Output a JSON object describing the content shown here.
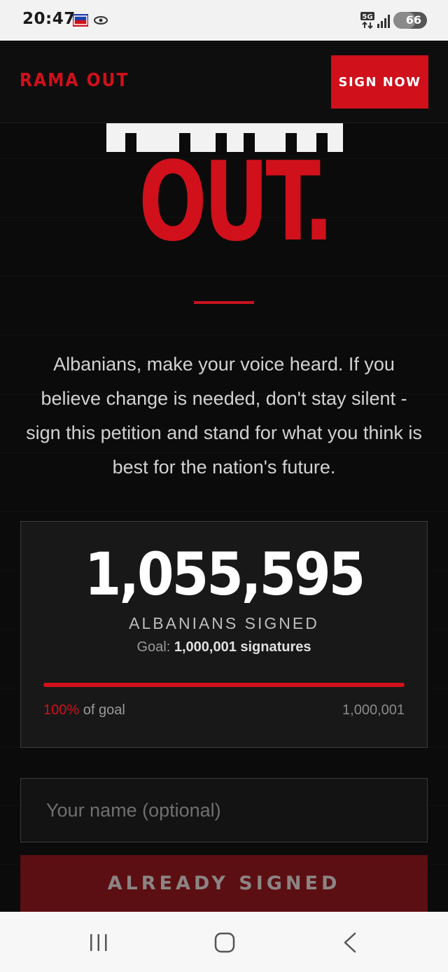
{
  "status_bar": {
    "time": "20:47",
    "battery": "66"
  },
  "header": {
    "brand": "RAMA OUT",
    "cta_label": "SIGN NOW"
  },
  "hero": {
    "title_top": "RAMA",
    "title_bottom": "OUT."
  },
  "intro": "Albanians, make your voice heard. If you believe change is needed, don't stay silent - sign this petition and stand for what you think is best for the nation's future.",
  "stats": {
    "count": "1,055,595",
    "count_label": "ALBANIANS SIGNED",
    "goal_prefix": "Goal:",
    "goal_value": "1,000,001 signatures",
    "progress_fraction": 1.0,
    "percent": "100%",
    "percent_suffix": "of goal",
    "goal_number": "1,000,001"
  },
  "form": {
    "name_placeholder": "Your name (optional)",
    "submit_label": "ALREADY SIGNED"
  },
  "colors": {
    "accent": "#d0101b",
    "background": "#0b0b0b",
    "card": "#181818",
    "disabled_button": "#5c0f12"
  },
  "icons": [
    "5g-icon",
    "signal-icon",
    "battery-icon",
    "recent-apps-icon",
    "home-icon",
    "back-icon"
  ]
}
